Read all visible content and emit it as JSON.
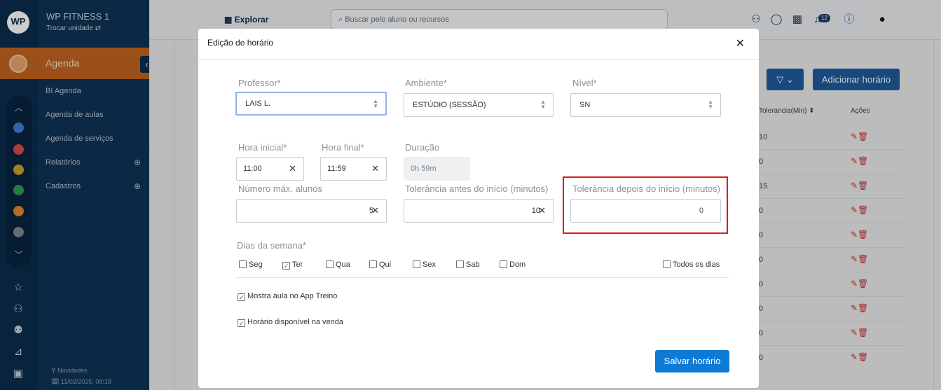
{
  "app": {
    "brand": "WP FITNESS 1",
    "switch_unit": "Trocar unidade ⇄",
    "logo_text": "WP",
    "accent": "#c1651f",
    "sidebar_bg": "#0e3256"
  },
  "sidebar": {
    "active": "Agenda",
    "items": [
      {
        "label": "BI Agenda"
      },
      {
        "label": "Agenda de aulas"
      },
      {
        "label": "Agenda de serviços"
      },
      {
        "label": "Relatórios"
      },
      {
        "label": "Cadastros"
      }
    ],
    "footer_news": "⚲ Novidades",
    "footer_date": "🗓 11/02/2025, 09:18"
  },
  "topbar": {
    "explore": "Explorar",
    "search_placeholder": "Buscar pelo aluno ou recursos",
    "notif_count": "12"
  },
  "background": {
    "add_button": "Adicionar horário",
    "col_tolerance": "Tolerancia(Min) ⬍",
    "col_actions": "Ações",
    "rows": [
      "10",
      "0",
      "15",
      "0",
      "0",
      "0",
      "0",
      "0",
      "0",
      "0"
    ]
  },
  "modal": {
    "title": "Edição de horário",
    "professor": {
      "label": "Professor*",
      "value": "LAIS L."
    },
    "ambiente": {
      "label": "Ambiente*",
      "value": "ESTÚDIO (SESSÃO)"
    },
    "nivel": {
      "label": "Nível*",
      "value": "SN"
    },
    "hora_inicial": {
      "label": "Hora inicial*",
      "value": "11:00"
    },
    "hora_final": {
      "label": "Hora final*",
      "value": "11:59"
    },
    "duracao": {
      "label": "Duração",
      "value": "0h 59m"
    },
    "max_alunos": {
      "label": "Número máx. alunos",
      "value": "5"
    },
    "tol_antes": {
      "label": "Tolerância antes do início (minutos)",
      "value": "10"
    },
    "tol_depois": {
      "label": "Tolerância depois do início (minutos)",
      "value": "0"
    },
    "dias_label": "Dias da semana*",
    "dias": [
      {
        "label": "Seg",
        "checked": false
      },
      {
        "label": "Ter",
        "checked": true
      },
      {
        "label": "Qua",
        "checked": false
      },
      {
        "label": "Qui",
        "checked": false
      },
      {
        "label": "Sex",
        "checked": false
      },
      {
        "label": "Sab",
        "checked": false
      },
      {
        "label": "Dom",
        "checked": false
      }
    ],
    "todos": {
      "label": "Todos os dias",
      "checked": false
    },
    "mostra_app": {
      "label": "Mostra aula no App Treino",
      "checked": true
    },
    "disponivel_venda": {
      "label": "Horário disponível na venda",
      "checked": true
    },
    "save": "Salvar horário"
  }
}
